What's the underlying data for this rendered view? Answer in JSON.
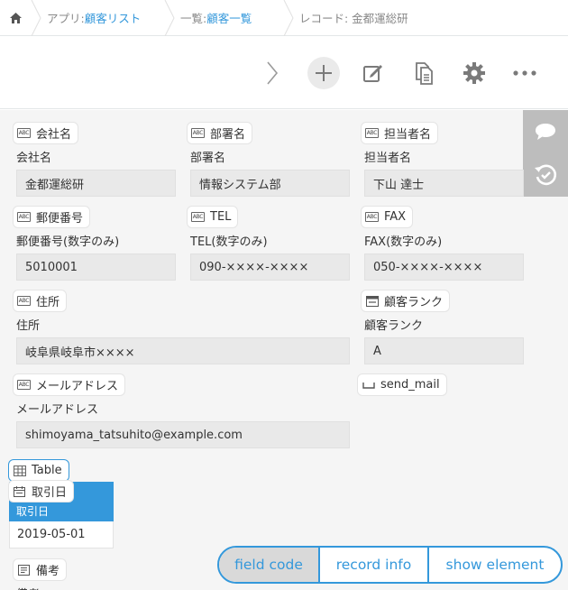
{
  "breadcrumb": {
    "app_prefix": "アプリ: ",
    "app_name": "顧客リスト",
    "view_prefix": "一覧: ",
    "view_name": "顧客一覧",
    "record": "レコード: 金都運総研"
  },
  "toolbar": {
    "icons": [
      "next-icon",
      "add-icon",
      "edit-icon",
      "copy-icon",
      "gear-icon",
      "more-icon"
    ]
  },
  "side_actions": {
    "icons": [
      "comment-icon",
      "history-icon"
    ]
  },
  "fields": {
    "company": {
      "code": "会社名",
      "label": "会社名",
      "value": "金都運総研"
    },
    "department": {
      "code": "部署名",
      "label": "部署名",
      "value": "情報システム部"
    },
    "person": {
      "code": "担当者名",
      "label": "担当者名",
      "value": "下山 達士"
    },
    "zip": {
      "code": "郵便番号",
      "label": "郵便番号(数字のみ)",
      "value": "5010001"
    },
    "tel": {
      "code": "TEL",
      "label": "TEL(数字のみ)",
      "value": "090-××××-××××"
    },
    "fax": {
      "code": "FAX",
      "label": "FAX(数字のみ)",
      "value": "050-××××-××××"
    },
    "address": {
      "code": "住所",
      "label": "住所",
      "value": "岐阜県岐阜市××××"
    },
    "rank": {
      "code": "顧客ランク",
      "label": "顧客ランク",
      "value": "A"
    },
    "email": {
      "code": "メールアドレス",
      "label": "メールアドレス",
      "value": "shimoyama_tatsuhito@example.com"
    },
    "send_mail": {
      "code": "send_mail"
    },
    "table": {
      "code": "Table"
    },
    "trade_date": {
      "code": "取引日",
      "label": "取引日",
      "value": "2019-05-01"
    },
    "notes": {
      "code": "備考",
      "label": "備考"
    }
  },
  "toggle": {
    "field_code": "field code",
    "record_info": "record info",
    "show_element": "show element",
    "active": "field_code"
  },
  "colors": {
    "accent": "#3498db",
    "background": "#f5f5f5",
    "value_bg": "#e9e9e9"
  }
}
